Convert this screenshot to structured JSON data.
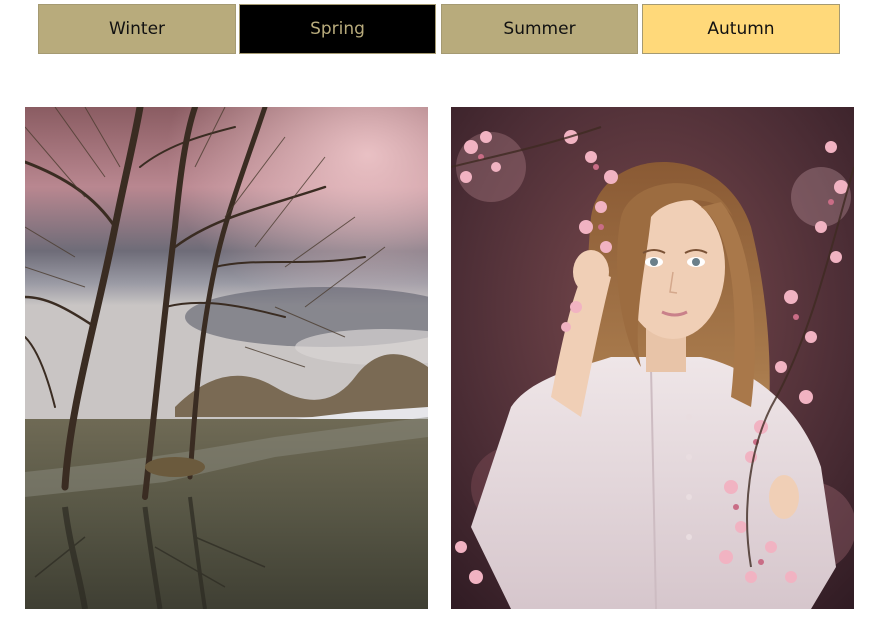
{
  "tabs": [
    {
      "label": "Winter",
      "active": false
    },
    {
      "label": "Spring",
      "active": true
    },
    {
      "label": "Summer",
      "active": false
    },
    {
      "label": "Autumn",
      "active": false,
      "highlight": true
    }
  ],
  "colors": {
    "tab_default_bg": "#b8ab7c",
    "tab_default_text": "#111111",
    "tab_active_bg": "#000000",
    "tab_active_text": "#b8ab7c",
    "tab_highlight_bg": "#ffd97a",
    "tab_highlight_text": "#111111"
  },
  "images": [
    {
      "name": "winter-river-trees-image"
    },
    {
      "name": "girl-blossoms-image"
    }
  ]
}
